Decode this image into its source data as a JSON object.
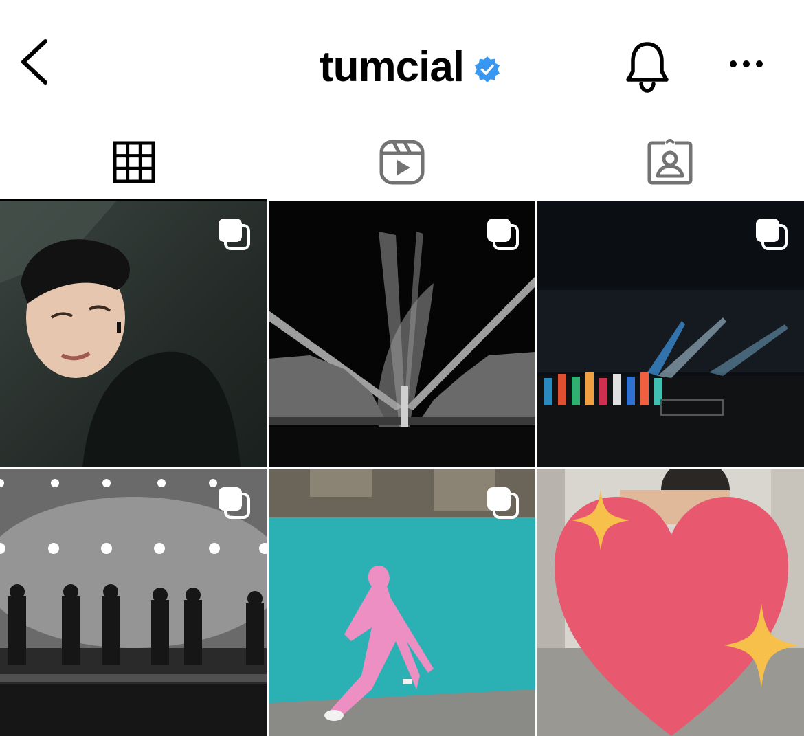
{
  "header": {
    "username": "tumcial",
    "verified": true,
    "back_icon": "chevron-left-icon",
    "bell_icon": "bell-icon",
    "more_icon": "more-horizontal-icon",
    "verified_color": "#3897f0"
  },
  "tabs": [
    {
      "name": "posts",
      "icon": "grid-icon",
      "active": true
    },
    {
      "name": "reels",
      "icon": "reels-icon",
      "active": false
    },
    {
      "name": "tagged",
      "icon": "tagged-person-icon",
      "active": false
    }
  ],
  "posts": [
    {
      "subject": "portrait-photo",
      "multi": true
    },
    {
      "subject": "concert-spotlight-bw",
      "multi": true
    },
    {
      "subject": "concert-stage-dancers",
      "multi": true
    },
    {
      "subject": "group-stage-bw",
      "multi": true
    },
    {
      "subject": "pink-outfit-teal-wall",
      "multi": true
    },
    {
      "subject": "heart-emoji-overlay",
      "multi": false
    }
  ]
}
